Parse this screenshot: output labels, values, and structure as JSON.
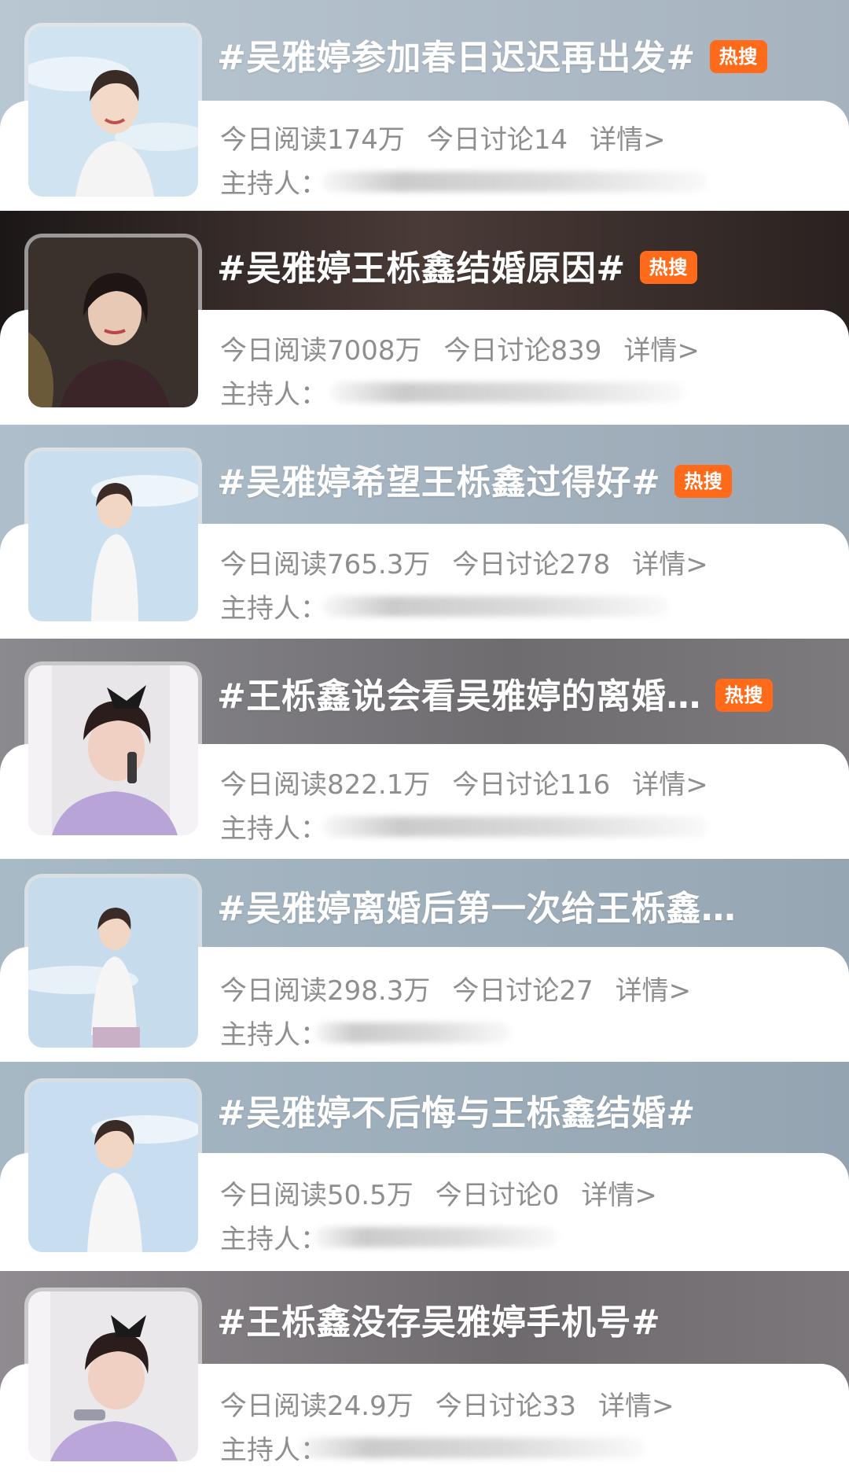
{
  "labels": {
    "host": "主持人："
  },
  "colors": {
    "hot_badge": "#ff6b1a",
    "text_gray": "#8e8e8e"
  },
  "topics": [
    {
      "title": "#吴雅婷参加春日迟迟再出发#",
      "badge": "热搜",
      "reads": "今日阅读174万",
      "discussions": "今日讨论14",
      "details": "详情>",
      "image": "woman-sky-portrait"
    },
    {
      "title": "#吴雅婷王栎鑫结婚原因#",
      "badge": "热搜",
      "reads": "今日阅读7008万",
      "discussions": "今日讨论839",
      "details": "详情>",
      "image": "woman-dark-portrait"
    },
    {
      "title": "#吴雅婷希望王栎鑫过得好#",
      "badge": "热搜",
      "reads": "今日阅读765.3万",
      "discussions": "今日讨论278",
      "details": "详情>",
      "image": "woman-sky-portrait"
    },
    {
      "title": "#王栎鑫说会看吴雅婷的离婚…",
      "badge": "热搜",
      "reads": "今日阅读822.1万",
      "discussions": "今日讨论116",
      "details": "详情>",
      "image": "woman-on-phone"
    },
    {
      "title": "#吴雅婷离婚后第一次给王栎鑫…",
      "badge": "",
      "reads": "今日阅读298.3万",
      "discussions": "今日讨论27",
      "details": "详情>",
      "image": "woman-sky-portrait"
    },
    {
      "title": "#吴雅婷不后悔与王栎鑫结婚#",
      "badge": "",
      "reads": "今日阅读50.5万",
      "discussions": "今日讨论0",
      "details": "详情>",
      "image": "woman-sky-portrait"
    },
    {
      "title": "#王栎鑫没存吴雅婷手机号#",
      "badge": "",
      "reads": "今日阅读24.9万",
      "discussions": "今日讨论33",
      "details": "详情>",
      "image": "woman-on-phone"
    }
  ]
}
